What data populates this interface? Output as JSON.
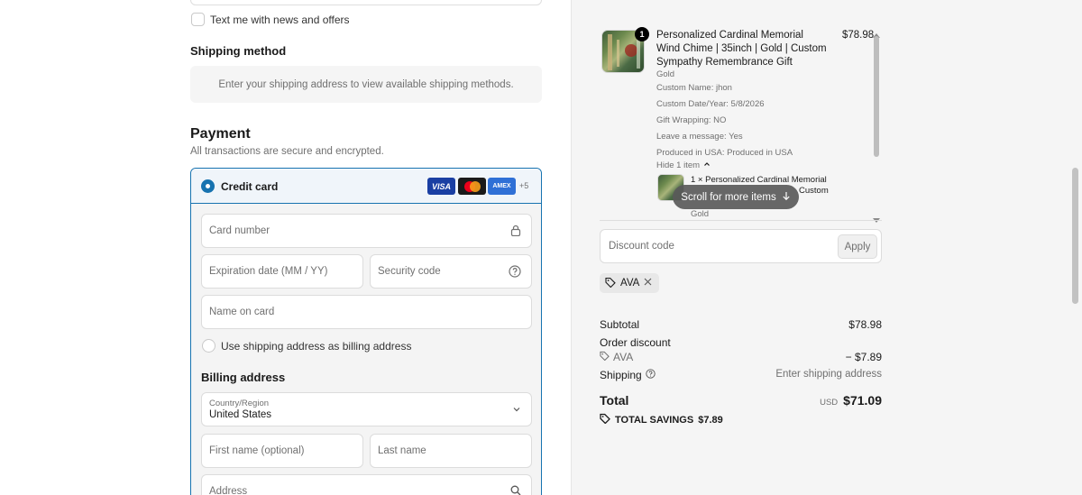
{
  "marketing": {
    "sms_label": "Text me with news and offers"
  },
  "shipping": {
    "heading": "Shipping method",
    "placeholder_text": "Enter your shipping address to view available shipping methods."
  },
  "payment": {
    "heading": "Payment",
    "subtext": "All transactions are secure and encrypted.",
    "method_label": "Credit card",
    "cards": [
      "VISA",
      "MC",
      "AMEX"
    ],
    "more_cards": "+5",
    "card_number_placeholder": "Card number",
    "expiry_placeholder": "Expiration date (MM / YY)",
    "security_placeholder": "Security code",
    "name_placeholder": "Name on card",
    "use_shipping_label": "Use shipping address as billing address",
    "billing_heading": "Billing address",
    "country_label": "Country/Region",
    "country_value": "United States",
    "first_name_placeholder": "First name (optional)",
    "last_name_placeholder": "Last name",
    "address_placeholder": "Address"
  },
  "summary": {
    "item": {
      "quantity": "1",
      "title": "Personalized Cardinal Memorial Wind Chime | 35inch | Gold | Custom Sympathy Remembrance Gift",
      "price": "$78.98",
      "variant": "Gold",
      "custom_name": "Custom Name: jhon",
      "custom_date": "Custom Date/Year: 5/8/2026",
      "gift_wrapping": "Gift Wrapping: NO",
      "leave_message": "Leave a message: Yes",
      "produced": "Produced in USA: Produced in USA",
      "hide_items": "Hide 1 item"
    },
    "bundle_item": {
      "line1": "1 × Personalized Cardinal Memorial",
      "line2": "Custom",
      "variant": "Gold"
    },
    "scroll_hint": "Scroll for more items",
    "discount_placeholder": "Discount code",
    "apply_label": "Apply",
    "applied_code": "AVA",
    "subtotal_label": "Subtotal",
    "subtotal_value": "$78.98",
    "order_discount_label": "Order discount",
    "discount_code": "AVA",
    "discount_value": "− $7.89",
    "shipping_label": "Shipping",
    "shipping_value": "Enter shipping address",
    "total_label": "Total",
    "currency": "USD",
    "total_value": "$71.09",
    "savings_label": "TOTAL SAVINGS",
    "savings_value": "$7.89"
  },
  "colors": {
    "accent": "#1773b0",
    "summary_bg": "#f5f5f5"
  }
}
